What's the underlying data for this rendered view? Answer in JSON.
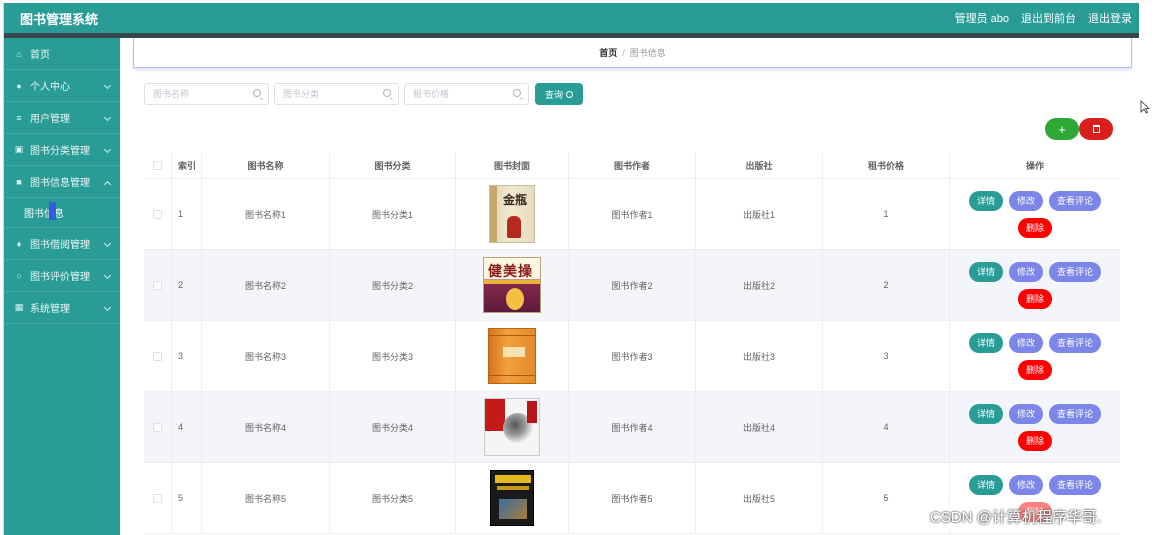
{
  "app": {
    "title": "图书管理系统",
    "accent_color": "#2a9c96",
    "header_links": [
      "管理员 abo",
      "退出到前台",
      "退出登录"
    ]
  },
  "sidebar": {
    "items": [
      {
        "label": "首页",
        "icon": "home-icon"
      },
      {
        "label": "个人中心",
        "icon": "user-icon"
      },
      {
        "label": "用户管理",
        "icon": "list-icon"
      },
      {
        "label": "图书分类管理",
        "icon": "box-icon"
      },
      {
        "label": "图书信息管理",
        "icon": "folder-icon"
      },
      {
        "label": "图书借阅管理",
        "icon": "pin-icon"
      },
      {
        "label": "图书评价管理",
        "icon": "circle-icon"
      },
      {
        "label": "系统管理",
        "icon": "grid-icon"
      }
    ],
    "submenu": {
      "label": "图书信息"
    }
  },
  "breadcrumb": {
    "home": "首页",
    "separator": "/",
    "current": "图书信息"
  },
  "search": {
    "name_placeholder": "图书名称",
    "category_placeholder": "图书分类",
    "price_placeholder": "租书价格",
    "query_label": "查询"
  },
  "actions": {
    "add_label": "+"
  },
  "table": {
    "headers": [
      "索引",
      "图书名称",
      "图书分类",
      "图书封面",
      "图书作者",
      "出版社",
      "租书价格",
      "操作"
    ],
    "rows": [
      {
        "index": "1",
        "name": "图书名称1",
        "category": "图书分类1",
        "author": "图书作者1",
        "publisher": "出版社1",
        "price": "1"
      },
      {
        "index": "2",
        "name": "图书名称2",
        "category": "图书分类2",
        "author": "图书作者2",
        "publisher": "出版社2",
        "price": "2"
      },
      {
        "index": "3",
        "name": "图书名称3",
        "category": "图书分类3",
        "author": "图书作者3",
        "publisher": "出版社3",
        "price": "3"
      },
      {
        "index": "4",
        "name": "图书名称4",
        "category": "图书分类4",
        "author": "图书作者4",
        "publisher": "出版社4",
        "price": "4"
      },
      {
        "index": "5",
        "name": "图书名称5",
        "category": "图书分类5",
        "author": "图书作者5",
        "publisher": "出版社5",
        "price": "5"
      }
    ],
    "buttons": {
      "detail": "详情",
      "edit": "修改",
      "comment": "查看评论",
      "delete": "删除"
    }
  },
  "covers": {
    "book1_title": "金瓶",
    "book2_title": "健美操"
  },
  "watermark": "CSDN @计算机程序华哥."
}
